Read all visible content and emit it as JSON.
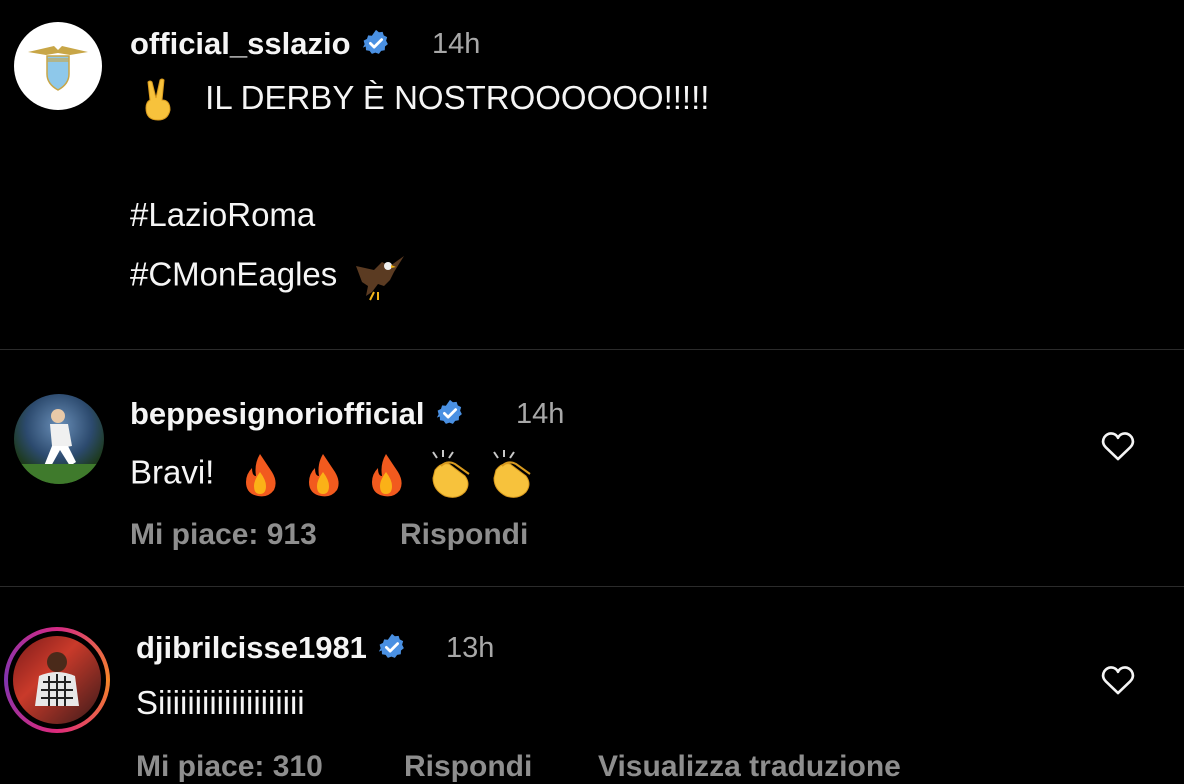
{
  "colors": {
    "background": "#000000",
    "text": "#f5f5f5",
    "muted": "#8e8e8e",
    "verified": "#4a90e2",
    "divider": "#2b2b2b"
  },
  "post": {
    "username": "official_sslazio",
    "time": "14h",
    "line1_emoji": "victory-hand-emoji",
    "line1": "IL DERBY È NOSTROOOOOO!!!!!",
    "hashtag1": "#LazioRoma",
    "hashtag2": "#CMonEagles",
    "hashtag2_emoji": "eagle-emoji"
  },
  "comments": [
    {
      "username": "beppesignoriofficial",
      "time": "14h",
      "text": "Bravi!",
      "emojis": [
        "fire-emoji",
        "fire-emoji",
        "fire-emoji",
        "clapping-hands-emoji",
        "clapping-hands-emoji"
      ],
      "likes": "Mi piace: 913",
      "reply": "Rispondi"
    },
    {
      "username": "djibrilcisse1981",
      "time": "13h",
      "text": "Siiiiiiiiiiiiiiiiiiii",
      "likes": "Mi piace: 310",
      "reply": "Rispondi",
      "translate": "Visualizza traduzione"
    }
  ]
}
